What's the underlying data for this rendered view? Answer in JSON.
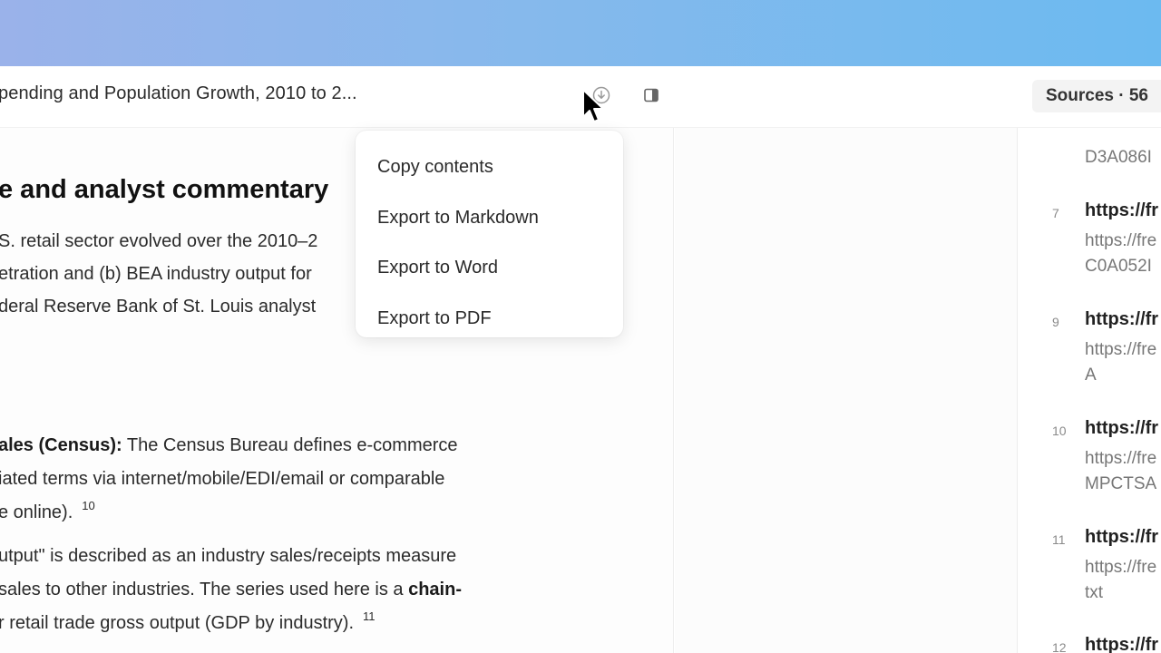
{
  "header": {
    "doc_title": "pending and Population Growth, 2010 to 2...",
    "download_icon": "download-circle-icon",
    "panel_icon": "sidebar-panel-icon",
    "sources_tab": "Sources · 56"
  },
  "export_menu": {
    "items": [
      {
        "label": "Copy contents"
      },
      {
        "label": "Export to Markdown"
      },
      {
        "label": "Export to Word"
      },
      {
        "label": "Export to PDF"
      }
    ]
  },
  "content": {
    "heading": "e and analyst commentary",
    "intro_lines": [
      "S. retail sector evolved over the 2010–2",
      "etration and (b) BEA industry output for",
      "deral Reserve Bank of St. Louis analyst"
    ],
    "def1": {
      "bold": "ales (Census):",
      "line1_rest": " The Census Bureau defines e-commerce",
      "line2": "iated terms via internet/mobile/EDI/email or comparable",
      "line3": "e online).",
      "ref": "10"
    },
    "def2": {
      "line1": "utput\" is described as an industry sales/receipts measure",
      "line2_text": " sales to other industries. The series used here is a ",
      "line2_bold": "chain-",
      "line3": "r retail trade gross output (GDP by industry).",
      "ref": "11"
    }
  },
  "sources": {
    "items": [
      {
        "num": "",
        "title": "",
        "url_lines": [
          "D3A086I"
        ]
      },
      {
        "num": "7",
        "title": "https://fr",
        "url_lines": [
          "https://fre",
          "C0A052I"
        ]
      },
      {
        "num": "9",
        "title": "https://fr",
        "url_lines": [
          "https://fre",
          "A"
        ]
      },
      {
        "num": "10",
        "title": "https://fr",
        "url_lines": [
          "https://fre",
          "MPCTSA"
        ]
      },
      {
        "num": "11",
        "title": "https://fr",
        "url_lines": [
          "https://fre",
          "txt"
        ]
      },
      {
        "num": "12",
        "title": "https://fr",
        "url_lines": []
      }
    ]
  },
  "colors": {
    "gradient_start": "#9ab2ea",
    "gradient_end": "#6cbaf0",
    "menu_bg": "#ffffff",
    "sources_tab_bg": "#f3f3f3"
  }
}
